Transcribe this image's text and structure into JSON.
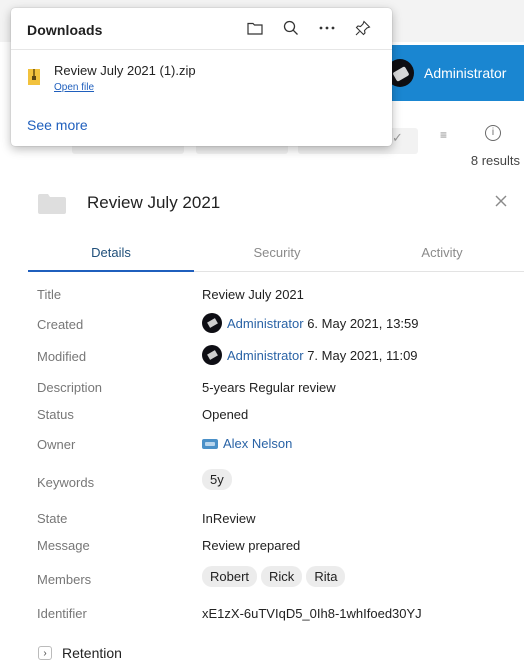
{
  "header": {
    "user_name": "Administrator"
  },
  "toolbar": {
    "results": "8 results"
  },
  "downloads": {
    "title": "Downloads",
    "icons": [
      "folder-icon",
      "search-icon",
      "more-icon",
      "pin-icon"
    ],
    "item": {
      "filename": "Review July 2021 (1).zip",
      "action": "Open file"
    },
    "see_more": "See more"
  },
  "panel": {
    "title": "Review July 2021",
    "tabs": [
      "Details",
      "Security",
      "Activity"
    ],
    "active_tab": "Details",
    "rows": [
      {
        "label": "Title",
        "value": "Review July 2021"
      },
      {
        "label": "Created",
        "user": "Administrator",
        "date": "6. May 2021, 13:59"
      },
      {
        "label": "Modified",
        "user": "Administrator",
        "date": "7. May 2021, 11:09"
      },
      {
        "label": "Description",
        "value": "5-years Regular review"
      },
      {
        "label": "Status",
        "value": "Opened"
      },
      {
        "label": "Owner",
        "value": "Alex Nelson"
      },
      {
        "label": "Keywords",
        "chips": [
          "5y"
        ]
      },
      {
        "label": "State",
        "value": "InReview"
      },
      {
        "label": "Message",
        "value": "Review prepared"
      },
      {
        "label": "Members",
        "chips": [
          "Robert",
          "Rick",
          "Rita"
        ]
      },
      {
        "label": "Identifier",
        "value": "xE1zX-6uTVIqD5_0Ih8-1whIfoed30YJ"
      }
    ],
    "retention_label": "Retention"
  },
  "colors": {
    "accent": "#1a86d1",
    "link": "#1f5fbd"
  }
}
